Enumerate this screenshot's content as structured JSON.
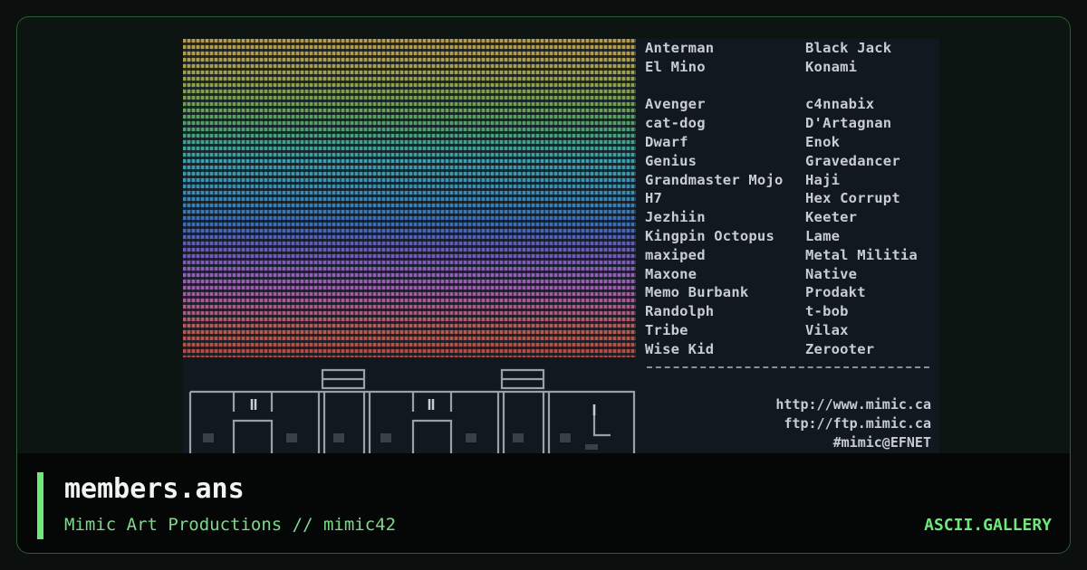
{
  "artwork": {
    "names": [
      [
        "Anterman",
        "Black Jack"
      ],
      [
        "El Mino",
        "Konami"
      ],
      [
        "",
        ""
      ],
      [
        "Avenger",
        "c4nnabix"
      ],
      [
        "cat-dog",
        "D'Artagnan"
      ],
      [
        "Dwarf",
        "Enok"
      ],
      [
        "Genius",
        "Gravedancer"
      ],
      [
        "Grandmaster Mojo",
        "Haji"
      ],
      [
        "H7",
        "Hex Corrupt"
      ],
      [
        "Jezhiin",
        "Keeter"
      ],
      [
        "Kingpin Octopus",
        "Lame"
      ],
      [
        "maxiped",
        "Metal Militia"
      ],
      [
        "Maxone",
        "Native"
      ],
      [
        "Memo Burbank",
        "Prodakt"
      ],
      [
        "Randolph",
        "t-bob"
      ],
      [
        "Tribe",
        "Vilax"
      ],
      [
        "Wise Kid",
        "Zerooter"
      ]
    ],
    "contact": {
      "web": "http://www.mimic.ca",
      "ftp": "ftp://ftp.mimic.ca",
      "irc": "#mimic@EFNET"
    }
  },
  "file": {
    "name": "members.ans",
    "credits": "Mimic Art Productions // mimic42"
  },
  "brand": "ASCII.GALLERY",
  "colors": {
    "accent": "#6ee87a",
    "frame_border": "#2a5e34",
    "title": "#f2f4f3",
    "subtitle": "#7fd88a"
  }
}
